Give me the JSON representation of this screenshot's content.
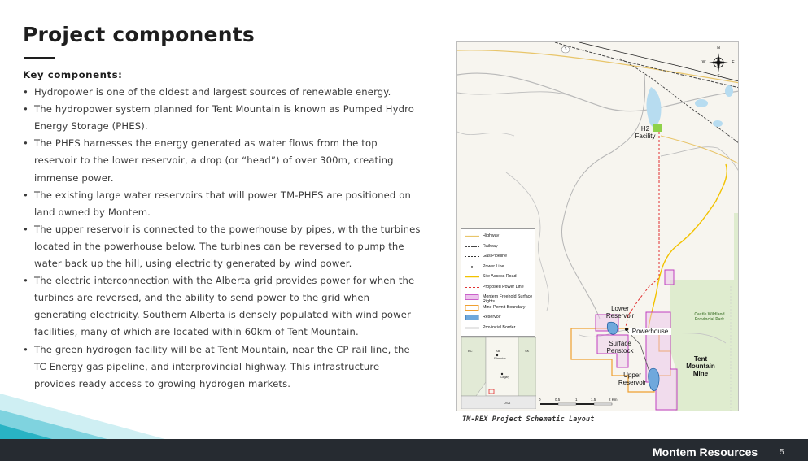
{
  "slide": {
    "title": "Project components",
    "heading": "Key components:",
    "bullets": [
      "Hydropower is one of the oldest and largest sources of renewable energy.",
      "The hydropower system planned for Tent Mountain is known as Pumped Hydro Energy Storage (PHES).",
      "The PHES harnesses the energy generated as water flows from the top reservoir to the lower reservoir, a drop (or “head”) of over 300m, creating immense power.",
      "The existing large water reservoirs that will power TM-PHES are positioned on land owned by Montem.",
      "The upper reservoir is connected to the powerhouse by pipes, with the turbines located in the powerhouse below. The turbines can be reversed to pump the water back up the hill, using electricity generated by wind power.",
      "The electric interconnection with the Alberta grid provides power for when the turbines are reversed, and the ability to send power to the grid when generating electricity. Southern Alberta is densely populated with wind power facilities, many of which are located within 60km of Tent Mountain.",
      "The green hydrogen facility will be at Tent Mountain, near the CP rail line, the TC Energy gas pipeline, and interprovincial highway. This infrastructure provides ready access to growing hydrogen markets."
    ]
  },
  "map": {
    "caption": "TM-REX Project Schematic Layout",
    "labels": {
      "h2_facility": "H2 Facility",
      "lower_reservoir": "Lower Reservoir",
      "powerhouse": "Powerhouse",
      "surface_penstock": "Surface Penstock",
      "upper_reservoir": "Upper Reservoir",
      "tent_mountain_mine": "Tent Mountain Mine",
      "park": "Castle Wildland Provincial Park",
      "highway_shield": "3"
    },
    "compass": {
      "n": "N",
      "s": "S",
      "e": "E",
      "w": "W"
    },
    "legend": [
      {
        "label": "Highway",
        "color": "#e8c56a"
      },
      {
        "label": "Railway",
        "color": "#444444"
      },
      {
        "label": "Gas Pipeline",
        "color": "#333333"
      },
      {
        "label": "Power Line",
        "color": "#222222"
      },
      {
        "label": "Site Access Road",
        "color": "#f2c200"
      },
      {
        "label": "Proposed Power Line",
        "color": "#e03030"
      },
      {
        "label": "Montem Freehold Surface Rights",
        "color": "#c040c0"
      },
      {
        "label": "Mine Permit Boundary",
        "color": "#f0a030"
      },
      {
        "label": "Reservoir",
        "color": "#6fa8dc"
      },
      {
        "label": "Provincial Border",
        "color": "#9a9a9a"
      }
    ],
    "inset": {
      "bc": "BC",
      "ab": "AB",
      "sk": "SK",
      "usa": "USA",
      "edmonton": "Edmonton",
      "calgary": "Calgary"
    },
    "scale": {
      "ticks": [
        "0",
        "0.5",
        "1",
        "1.5",
        "2 Km"
      ]
    }
  },
  "footer": {
    "brand": "Montem Resources",
    "page_number": "5"
  },
  "colors": {
    "footer_bg": "#262b31",
    "accent_teal": "#2fb8c9",
    "accent_light": "#a8e4ec",
    "title": "#1e1e1e"
  }
}
